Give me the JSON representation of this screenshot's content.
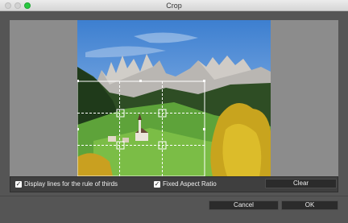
{
  "window": {
    "title": "Crop"
  },
  "options": {
    "rule_of_thirds_label": "Display lines for the rule of thirds",
    "rule_of_thirds_checked": true,
    "fixed_aspect_label": "Fixed Aspect Ratio",
    "fixed_aspect_checked": true
  },
  "buttons": {
    "clear": "Clear",
    "cancel": "Cancel",
    "ok": "OK"
  },
  "icons": {
    "check": "checkmark-icon"
  },
  "colors": {
    "accent_zoom": "#28c840",
    "panel": "#555555",
    "stage": "#8c8c8c"
  }
}
